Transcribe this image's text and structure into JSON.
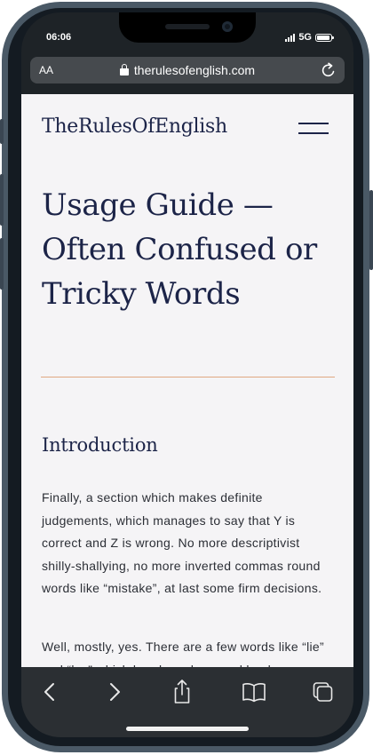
{
  "status_bar": {
    "time": "06:06",
    "network": "5G"
  },
  "browser": {
    "text_size_label": "AA",
    "url": "therulesofenglish.com"
  },
  "site": {
    "title": "TheRulesOfEnglish",
    "accent_color": "#1c2448",
    "divider_color": "#e0a882"
  },
  "page": {
    "heading": "Usage Guide — Often Confused or Tricky Words",
    "section_heading": "Introduction",
    "paragraph_1": "Finally, a section which makes definite judgements, which manages to say that Y is correct and Z is wrong. No more descriptivist shilly-shallying, no more inverted commas round words like “mistake”, at last some firm decisions.",
    "paragraph_2": "Well, mostly, yes. There are a few words like “lie” and “lay” which break us down and lead"
  },
  "toolbar_icons": [
    "back-icon",
    "forward-icon",
    "share-icon",
    "bookmarks-icon",
    "tabs-icon"
  ]
}
